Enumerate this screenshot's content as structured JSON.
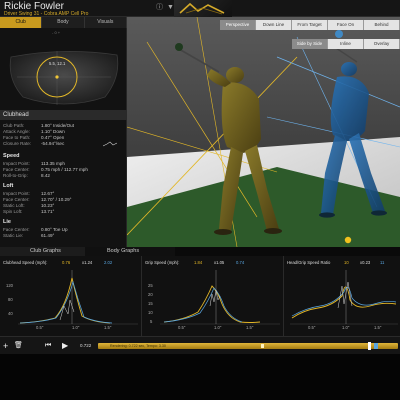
{
  "header": {
    "player_name": "Rickie Fowler",
    "swing_info": "Driver Swing 31 - Cobra AMP Cell Pro",
    "icons": [
      "info-icon",
      "dropdown-icon"
    ]
  },
  "left_panel": {
    "tabs": [
      "Club",
      "Body",
      "Visuals"
    ],
    "active_tab": "Club",
    "zoom_label": "- 0 +",
    "impact_label": "5.5, 12.1",
    "clubhead_title": "Clubhead",
    "clubhead_rows": [
      {
        "label": "Club Path:",
        "value": "1.80° Inside/Out"
      },
      {
        "label": "Attack Angle:",
        "value": "1.10° Down"
      },
      {
        "label": "Face to Path:",
        "value": "0.47° Open"
      },
      {
        "label": "Closure Rate:",
        "value": "-54.94°/sec"
      }
    ],
    "speed_title": "Speed",
    "speed_rows": [
      {
        "label": "Impact Point:",
        "value": "113.35 mph"
      },
      {
        "label": "Face Center:",
        "value": "0.75 mph / 112.77 mph"
      },
      {
        "label": "Roll-to-Grip:",
        "value": "8.42"
      }
    ],
    "loft_title": "Loft",
    "loft_rows": [
      {
        "label": "Impact Point:",
        "value": "12.67°"
      },
      {
        "label": "Face Center:",
        "value": "12.70° / 10.29°"
      },
      {
        "label": "Static Loft:",
        "value": "10.23°"
      },
      {
        "label": "Spin Loft:",
        "value": "13.71°"
      }
    ],
    "lie_title": "Lie",
    "lie_rows": [
      {
        "label": "Face Center:",
        "value": "0.80° Toe Up"
      },
      {
        "label": "Static Lie:",
        "value": "61.49°"
      }
    ]
  },
  "viewport": {
    "view_tabs": [
      "Perspective",
      "Down Line",
      "From Target",
      "Face On",
      "Behind"
    ],
    "active_view": "Perspective",
    "mode_tabs": [
      "Side by Side",
      "Inline",
      "Overlay"
    ],
    "active_mode": "Side by Side"
  },
  "graph_tabs": {
    "club": "Club Graphs",
    "body": "Body Graphs"
  },
  "graphs": [
    {
      "title": "Clubhead Speed (mph):",
      "readouts": [
        {
          "text": "0.76",
          "color": "#e3b626"
        },
        {
          "text": "x1.24",
          "color": "#dddddd"
        },
        {
          "text": "2.02",
          "color": "#5aa6e0"
        }
      ],
      "y_ticks": [
        "120",
        "80",
        "40"
      ],
      "x_ticks": [
        "0.5\"",
        "1.0\"",
        "1.5\""
      ]
    },
    {
      "title": "Grip Speed (mph):",
      "readouts": [
        {
          "text": "1.84",
          "color": "#e3b626"
        },
        {
          "text": "x1.05",
          "color": "#dddddd"
        },
        {
          "text": "0.74",
          "color": "#5aa6e0"
        }
      ],
      "y_ticks": [
        "25",
        "20",
        "15",
        "10",
        "5"
      ],
      "x_ticks": [
        "0.5\"",
        "1.0\"",
        "1.5\""
      ]
    },
    {
      "title": "Head/Grip Speed Ratio",
      "readouts": [
        {
          "text": "10",
          "color": "#e3b626"
        },
        {
          "text": "x0.23",
          "color": "#dddddd"
        },
        {
          "text": "11",
          "color": "#5aa6e0"
        }
      ],
      "y_ticks": [],
      "x_ticks": [
        "0.5\"",
        "1.0\"",
        "1.5\""
      ]
    }
  ],
  "timeline": {
    "time_value": "0.722",
    "scrub_text": "Rendering: 0.722 sec, Tempo: 3.30",
    "controls": [
      "add-icon",
      "delete-icon",
      "skip-back-icon",
      "play-icon"
    ]
  },
  "colors": {
    "accent": "#c89a1e",
    "blue": "#5aa6e0",
    "green": "#2e5a2a"
  }
}
